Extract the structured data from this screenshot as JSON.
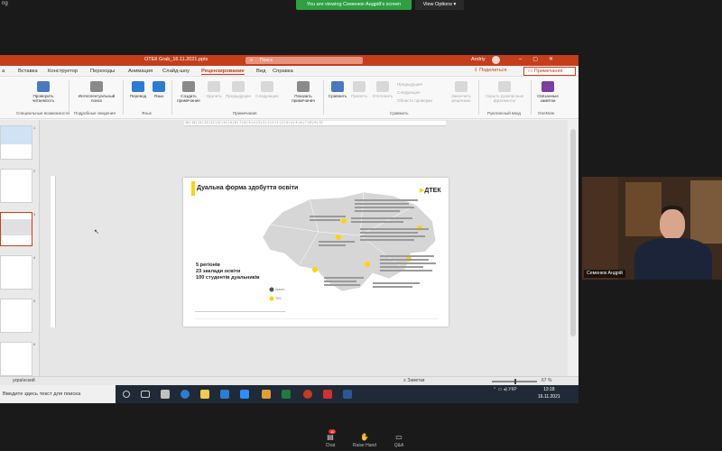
{
  "zoom": {
    "top_left_text": "ng",
    "viewing_banner": "You are viewing Семенюк Андрій's screen",
    "view_options": "View Options",
    "participant_name": "Семенюк Андрій",
    "controls": [
      {
        "label": "Chat",
        "icon": "chat-icon",
        "badge": "10"
      },
      {
        "label": "Raise Hand",
        "icon": "raise-hand-icon"
      },
      {
        "label": "Q&A",
        "icon": "qa-icon"
      }
    ]
  },
  "powerpoint": {
    "file_name": "ОТЕК Grab_16.11.2021.pptx",
    "search_placeholder": "Поиск",
    "user_name": "Andriy",
    "tabs": [
      "а",
      "Вставка",
      "Конструктор",
      "Переходы",
      "Анимация",
      "Слайд-шоу",
      "Рецензирование",
      "Вид",
      "Справка"
    ],
    "active_tab": "Рецензирование",
    "share_label": "Поделиться",
    "notes_label": "Примечания",
    "ribbon": {
      "buttons": [
        {
          "label": "Проверить читаемость",
          "color": "#4a78c2",
          "dim": false
        },
        {
          "label": "Интеллектуальный поиск",
          "color": "#8a8a8a",
          "dim": false
        },
        {
          "label": "Перевод",
          "color": "#2b7cd3",
          "dim": false
        },
        {
          "label": "Язык",
          "color": "#2b7cd3",
          "dim": false
        },
        {
          "label": "Создать примечание",
          "color": "#8a8a8a",
          "dim": false
        },
        {
          "label": "Удалить",
          "color": "#d8d8d8",
          "dim": true
        },
        {
          "label": "Предыдущее",
          "color": "#d8d8d8",
          "dim": true
        },
        {
          "label": "Следующее",
          "color": "#d8d8d8",
          "dim": true
        },
        {
          "label": "Показать примечания",
          "color": "#8a8a8a",
          "dim": false
        },
        {
          "label": "Сравнить",
          "color": "#4a78c2",
          "dim": false
        },
        {
          "label": "Принять",
          "color": "#d8d8d8",
          "dim": true
        },
        {
          "label": "Отклонить",
          "color": "#d8d8d8",
          "dim": true
        },
        {
          "label": "Закончить рецензию",
          "color": "#d8d8d8",
          "dim": true
        },
        {
          "label": "Скрыть рукописные фрагменты",
          "color": "#d8d8d8",
          "dim": true
        },
        {
          "label": "Связанные заметки",
          "color": "#7b3fa0",
          "dim": false
        }
      ],
      "compare_small": [
        "Предыдущее",
        "Следующее",
        "Область проверки"
      ],
      "groups": [
        "Специальные возможности",
        "Подробные сведения",
        "Язык",
        "Примечания",
        "Сравнить",
        "Рукописный ввод",
        "OneNote"
      ]
    },
    "thumbnail_numbers": [
      "1",
      "2",
      "3",
      "4",
      "5",
      "6",
      "7"
    ],
    "slide": {
      "title": "Дуальна форма здобуття освіти",
      "logo_text": "ДТЕК",
      "stats": [
        "5 регіонів",
        "23 заклади освіти",
        "100 студентів дуальників"
      ],
      "legend": [
        "Шахти",
        "ТЕС"
      ]
    },
    "status": {
      "language": "українский",
      "notes": "Заметки",
      "zoom": "67 %"
    }
  },
  "taskbar": {
    "search_text": "Введите здесь текст для поиска",
    "tray_text": "УКР",
    "time": "13:18",
    "date": "16.11.2021"
  }
}
